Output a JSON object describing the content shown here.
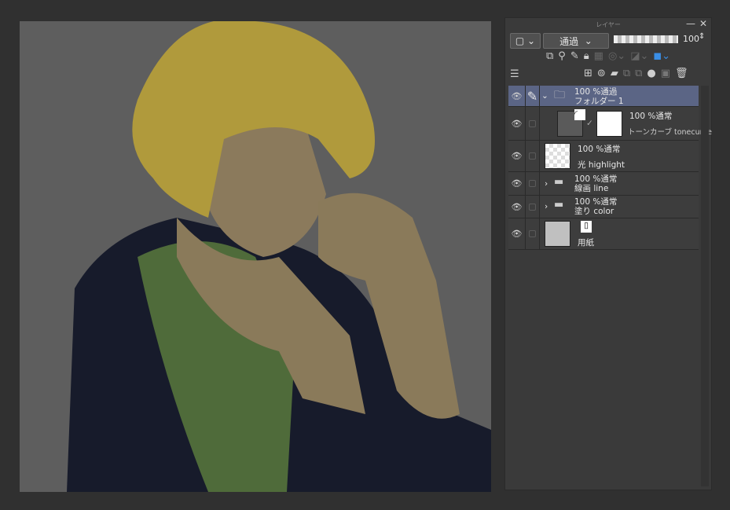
{
  "panel": {
    "title": "レイヤー",
    "minimize_icon": "minimize-icon",
    "close_icon": "close-icon",
    "blend_mode": "通過",
    "opacity": "100",
    "opacity_level": 100,
    "toolbar1": [
      "copy-layer-icon",
      "reference-layer-icon",
      "draft-layer-icon",
      "lock-icon",
      "lock-transparency-icon",
      "mask-icon",
      "clip-icon",
      "color-icon"
    ],
    "toolbar2": [
      "new-raster-layer-icon",
      "new-vector-layer-icon",
      "new-folder-icon",
      "transfer-down-icon",
      "merge-down-icon",
      "mask-create-icon",
      "apply-mask-icon",
      "delete-icon"
    ]
  },
  "layers": [
    {
      "mode": "100 %通過",
      "name": "フォルダー 1",
      "type": "folder",
      "expanded": true,
      "selected": true
    },
    {
      "mode": "100 %通常",
      "name": "トーンカーブ tonecurve",
      "type": "correction"
    },
    {
      "mode": "100 %通常",
      "name": "光  highlight",
      "type": "raster"
    },
    {
      "mode": "100 %通常",
      "name": "線画  line",
      "type": "folder",
      "expanded": false
    },
    {
      "mode": "100 %通常",
      "name": "塗り  color",
      "type": "folder",
      "expanded": false
    },
    {
      "mode": "",
      "name": "用紙",
      "type": "paper"
    }
  ],
  "colors": {
    "selected_row": "#5b6585",
    "canvas_bg": "#5e5e5e"
  }
}
